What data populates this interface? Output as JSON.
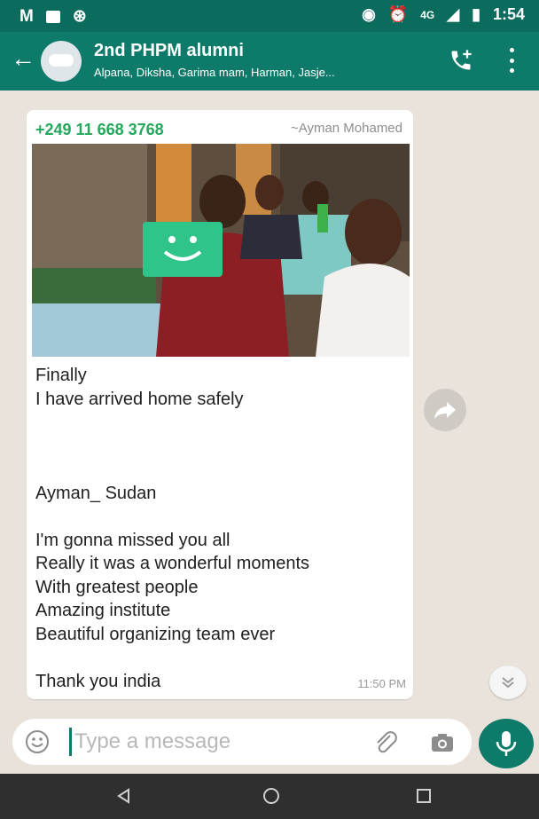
{
  "status_bar": {
    "network": "4G",
    "time": "1:54"
  },
  "chat_header": {
    "title": "2nd PHPM alumni",
    "participants": "Alpana, Diksha, Garima mam, Harman, Jasje..."
  },
  "message": {
    "sender_number": "+249 11 668 3768",
    "sender_name": "~Ayman Mohamed",
    "text": "Finally\nI have arrived home safely\n\n\n\nAyman_ Sudan\n\nI'm gonna missed you all\nReally it was a wonderful moments\nWith greatest people\nAmazing institute\nBeautiful organizing team ever\n\nThank you india",
    "time": "11:50 PM"
  },
  "composer": {
    "placeholder": "Type a message"
  },
  "colors": {
    "header": "#0e7a6a",
    "status_bar": "#0b6b5d",
    "sender": "#23a85c",
    "chat_bg": "#e9e3db"
  },
  "icons": [
    "back-arrow-icon",
    "add-call-icon",
    "more-vert-icon",
    "forward-icon",
    "scroll-down-icon",
    "emoji-icon",
    "attach-icon",
    "camera-icon",
    "mic-icon",
    "nav-back-icon",
    "nav-home-icon",
    "nav-recents-icon"
  ]
}
